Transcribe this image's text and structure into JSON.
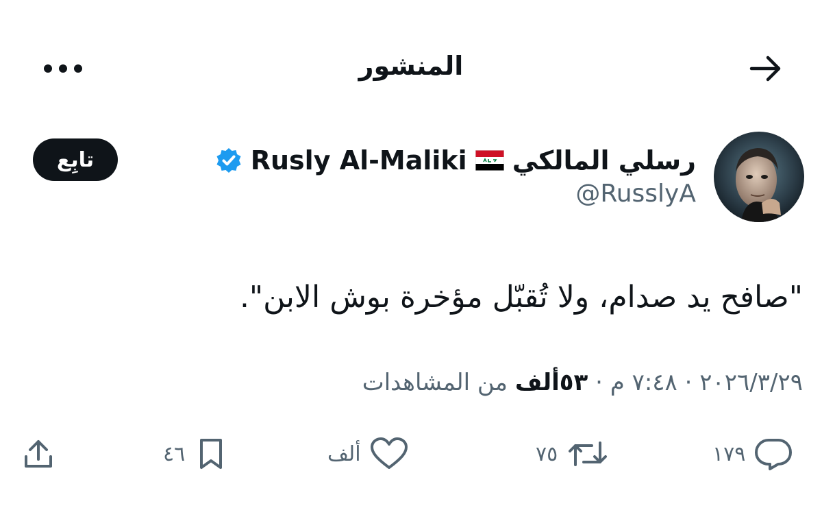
{
  "header": {
    "title": "المنشور",
    "back_icon": "arrow-right-icon",
    "more_icon": "more-horizontal-icon"
  },
  "author": {
    "display_name": "رسلي المالكي 🇮🇶 Rusly Al-Maliki",
    "name_arabic": "رسلي المالكي",
    "name_latin": "Rusly Al-Maliki",
    "handle": "@RusslyA",
    "verified": true,
    "verified_color": "#1d9bf0"
  },
  "follow_button": {
    "label": "تابِع"
  },
  "tweet": {
    "text": "\"صافح يد صدام، ولا تُقبّل مؤخرة بوش الابن\"."
  },
  "meta": {
    "date": "٢٠٢٦/٣/٢٩",
    "time": "٧:٤٨ م",
    "views_count": "٥٣ألف",
    "views_label": "من المشاهدات",
    "separator": "·"
  },
  "actions": {
    "replies": "١٧٩",
    "reposts": "٧٥",
    "likes": "ألف",
    "bookmarks": "٤٦"
  },
  "colors": {
    "text_primary": "#0f1419",
    "text_secondary": "#536471",
    "verified_blue": "#1d9bf0",
    "flag_red": "#ce1126",
    "flag_green": "#007a3d"
  }
}
